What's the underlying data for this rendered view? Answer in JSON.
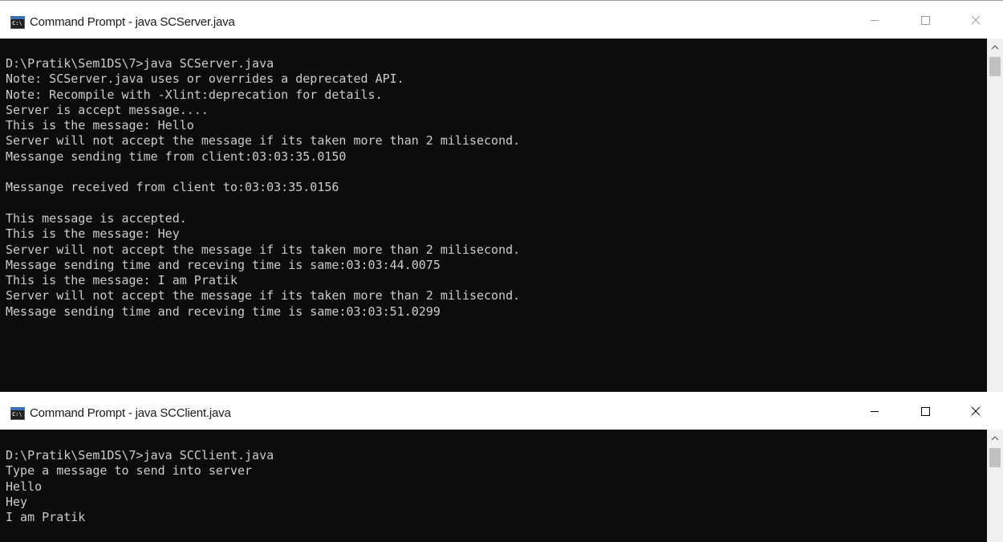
{
  "server_window": {
    "title": "Command Prompt - java  SCServer.java",
    "lines": [
      "D:\\Pratik\\Sem1DS\\7>java SCServer.java",
      "Note: SCServer.java uses or overrides a deprecated API.",
      "Note: Recompile with -Xlint:deprecation for details.",
      "Server is accept message....",
      "This is the message: Hello",
      "Server will not accept the message if its taken more than 2 milisecond.",
      "Messange sending time from client:03:03:35.0150",
      "",
      "Messange received from client to:03:03:35.0156",
      "",
      "This message is accepted.",
      "This is the message: Hey",
      "Server will not accept the message if its taken more than 2 milisecond.",
      "Message sending time and receving time is same:03:03:44.0075",
      "This is the message: I am Pratik",
      "Server will not accept the message if its taken more than 2 milisecond.",
      "Message sending time and receving time is same:03:03:51.0299"
    ]
  },
  "client_window": {
    "title": "Command Prompt - java  SCClient.java",
    "lines": [
      "D:\\Pratik\\Sem1DS\\7>java SCClient.java",
      "Type a message to send into server",
      "Hello",
      "Hey",
      "I am Pratik"
    ]
  },
  "icons": {
    "app": "cmd-icon",
    "app_glyph": "C:\\",
    "minimize": "minimize-icon",
    "maximize": "maximize-icon",
    "close": "close-icon",
    "scroll_up": "chevron-up-icon"
  },
  "colors": {
    "console_background": "#0c0c0c",
    "console_text": "#cccccc",
    "titlebar_background": "#ffffff",
    "active_caption_text": "#000000",
    "inactive_caption_glyph": "#999999"
  }
}
